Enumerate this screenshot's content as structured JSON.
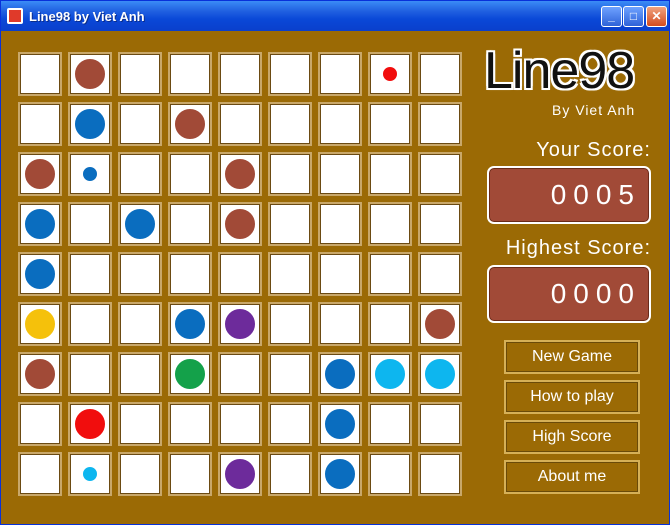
{
  "window": {
    "title": "Line98 by Viet Anh",
    "controls": [
      "minimize",
      "maximize",
      "close"
    ]
  },
  "logo": {
    "title": "Line98",
    "byline": "By Viet Anh"
  },
  "scores": {
    "your_label": "Your Score:",
    "your_value": "0005",
    "highest_label": "Highest Score:",
    "highest_value": "0000"
  },
  "buttons": {
    "new_game": "New Game",
    "how_to_play": "How to play",
    "high_score": "High Score",
    "about_me": "About me"
  },
  "colors": {
    "brown": "#a14a37",
    "blue": "#0a6dbf",
    "red": "#f10d0d",
    "yellow": "#f5c10b",
    "purple": "#6d2b9b",
    "green": "#14a14a",
    "cyan": "#0db6ef",
    "background": "#9b6a05"
  },
  "board": {
    "rows": 9,
    "cols": 9,
    "balls": [
      {
        "row": 0,
        "col": 1,
        "color": "brown",
        "size": "big"
      },
      {
        "row": 0,
        "col": 7,
        "color": "red",
        "size": "small"
      },
      {
        "row": 1,
        "col": 1,
        "color": "blue",
        "size": "big"
      },
      {
        "row": 1,
        "col": 3,
        "color": "brown",
        "size": "big"
      },
      {
        "row": 2,
        "col": 0,
        "color": "brown",
        "size": "big"
      },
      {
        "row": 2,
        "col": 1,
        "color": "blue",
        "size": "small"
      },
      {
        "row": 2,
        "col": 4,
        "color": "brown",
        "size": "big"
      },
      {
        "row": 3,
        "col": 0,
        "color": "blue",
        "size": "big"
      },
      {
        "row": 3,
        "col": 2,
        "color": "blue",
        "size": "big"
      },
      {
        "row": 3,
        "col": 4,
        "color": "brown",
        "size": "big"
      },
      {
        "row": 4,
        "col": 0,
        "color": "blue",
        "size": "big"
      },
      {
        "row": 5,
        "col": 0,
        "color": "yellow",
        "size": "big"
      },
      {
        "row": 5,
        "col": 3,
        "color": "blue",
        "size": "big"
      },
      {
        "row": 5,
        "col": 4,
        "color": "purple",
        "size": "big"
      },
      {
        "row": 5,
        "col": 8,
        "color": "brown",
        "size": "big"
      },
      {
        "row": 6,
        "col": 0,
        "color": "brown",
        "size": "big"
      },
      {
        "row": 6,
        "col": 3,
        "color": "green",
        "size": "big"
      },
      {
        "row": 6,
        "col": 6,
        "color": "blue",
        "size": "big"
      },
      {
        "row": 6,
        "col": 7,
        "color": "cyan",
        "size": "big"
      },
      {
        "row": 6,
        "col": 8,
        "color": "cyan",
        "size": "big"
      },
      {
        "row": 7,
        "col": 1,
        "color": "red",
        "size": "big"
      },
      {
        "row": 7,
        "col": 6,
        "color": "blue",
        "size": "big"
      },
      {
        "row": 8,
        "col": 1,
        "color": "cyan",
        "size": "small"
      },
      {
        "row": 8,
        "col": 4,
        "color": "purple",
        "size": "big"
      },
      {
        "row": 8,
        "col": 6,
        "color": "blue",
        "size": "big"
      }
    ]
  }
}
